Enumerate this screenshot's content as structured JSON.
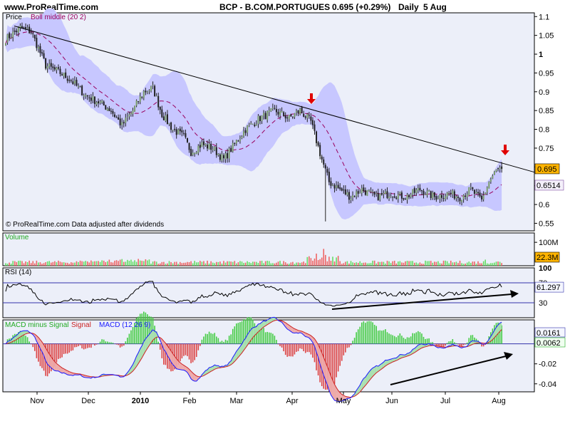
{
  "header": {
    "site": "www.ProRealTime.com",
    "title": "BCP - B.COM.PORTUGUES",
    "quote": "0.695 (+0.29%)",
    "period": "Daily",
    "date": "5 Aug"
  },
  "colors": {
    "panel_bg": "#eceff9",
    "bollinger_band": "#c7c7ff",
    "bollinger_mid": "#99005f",
    "candle_up": "#7a9c6a",
    "candle_down": "#222222",
    "trendline": "#000000",
    "arrow": "#e00000",
    "volume_up": "#66dd66",
    "volume_down": "#ee6666",
    "rsi_line": "#000000",
    "macd_hist_up": "#44cc44",
    "macd_hist_down": "#dd4444",
    "macd_line": "#1a1aff",
    "signal_line": "#cc2222",
    "price_tag": "#ffb400"
  },
  "x_axis": {
    "labels": [
      "Nov",
      "Dec",
      "2010",
      "Feb",
      "Mar",
      "Apr",
      "May",
      "Jun",
      "Jul",
      "Aug"
    ]
  },
  "chart_data": [
    {
      "type": "candlestick",
      "panel": "price",
      "legend": [
        "Price",
        "Boll middle (20 2)"
      ],
      "note": "© ProRealTime.com  Data adjusted after dividends",
      "ylim": [
        0.53,
        1.11
      ],
      "yticks": [
        "1.1",
        "1.05",
        "1",
        "0.95",
        "0.9",
        "0.85",
        "0.8",
        "0.75",
        "0.7",
        "0.65",
        "0.6",
        "0.55"
      ],
      "last_price_label": "0.695",
      "boll_mid_label": "0.6514",
      "trendline": {
        "from": [
          "Oct",
          1.075
        ],
        "to": [
          "Aug",
          0.695
        ]
      },
      "arrows": [
        "Apr",
        "Aug"
      ],
      "close_series": {
        "x_months": [
          "Oct",
          "Nov",
          "Dec",
          "Jan",
          "Feb",
          "Mar",
          "Apr",
          "May",
          "Jun",
          "Jul",
          "Aug"
        ],
        "anchors": [
          [
            0,
            1.04
          ],
          [
            8,
            1.07
          ],
          [
            14,
            1.06
          ],
          [
            22,
            0.97
          ],
          [
            30,
            0.95
          ],
          [
            36,
            0.93
          ],
          [
            44,
            0.89
          ],
          [
            52,
            0.87
          ],
          [
            58,
            0.85
          ],
          [
            64,
            0.81
          ],
          [
            70,
            0.85
          ],
          [
            76,
            0.9
          ],
          [
            81,
            0.91
          ],
          [
            86,
            0.84
          ],
          [
            92,
            0.8
          ],
          [
            98,
            0.78
          ],
          [
            102,
            0.74
          ],
          [
            108,
            0.76
          ],
          [
            114,
            0.75
          ],
          [
            120,
            0.72
          ],
          [
            126,
            0.76
          ],
          [
            132,
            0.8
          ],
          [
            140,
            0.83
          ],
          [
            148,
            0.85
          ],
          [
            156,
            0.83
          ],
          [
            162,
            0.85
          ],
          [
            168,
            0.82
          ],
          [
            174,
            0.72
          ],
          [
            178,
            0.66
          ],
          [
            184,
            0.64
          ],
          [
            190,
            0.62
          ],
          [
            196,
            0.64
          ],
          [
            204,
            0.62
          ],
          [
            212,
            0.63
          ],
          [
            220,
            0.62
          ],
          [
            228,
            0.64
          ],
          [
            236,
            0.62
          ],
          [
            244,
            0.63
          ],
          [
            250,
            0.62
          ],
          [
            256,
            0.64
          ],
          [
            262,
            0.61
          ],
          [
            266,
            0.66
          ],
          [
            270,
            0.69
          ],
          [
            273,
            0.695
          ]
        ]
      }
    },
    {
      "type": "bar",
      "panel": "volume",
      "legend": [
        "Volume"
      ],
      "yticks": [
        "100M"
      ],
      "last_value_label": "22.3M",
      "ylim": [
        0,
        140000000
      ]
    },
    {
      "type": "line",
      "panel": "rsi",
      "legend": [
        "RSI (14)"
      ],
      "ylim": [
        0,
        100
      ],
      "yticks": [
        "100",
        "70",
        "30"
      ],
      "levels": [
        70,
        30
      ],
      "last_value_label": "61.297"
    },
    {
      "type": "bar+line",
      "panel": "macd",
      "legend": [
        "MACD minus Signal",
        "Signal",
        "MACD (12 26 9)"
      ],
      "ylim": [
        -0.048,
        0.024
      ],
      "yticks": [
        "-0.02",
        "-0.04"
      ],
      "labels": [
        "0.0161",
        "0.0062"
      ]
    }
  ]
}
